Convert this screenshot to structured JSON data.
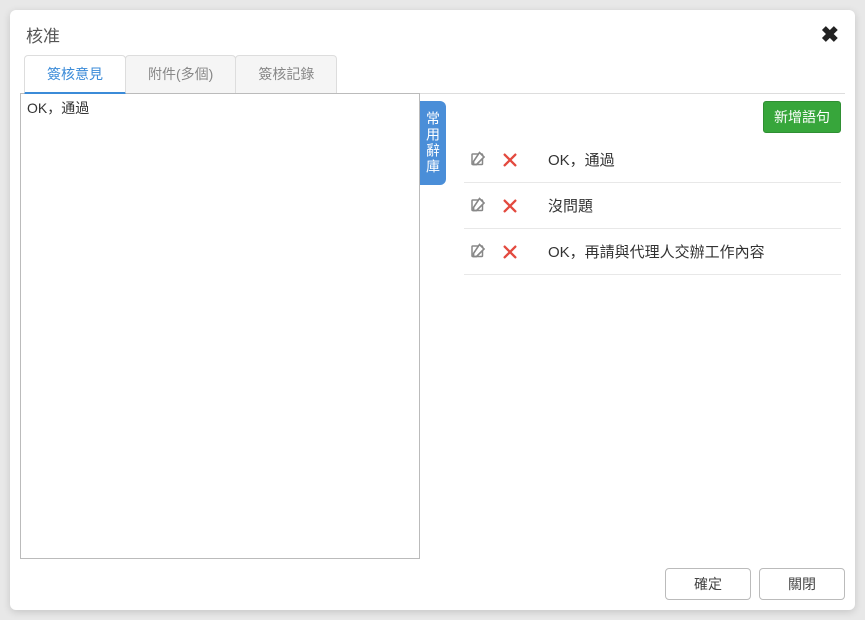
{
  "dialog": {
    "title": "核准"
  },
  "tabs": [
    {
      "label": "簽核意見",
      "active": true
    },
    {
      "label": "附件(多個)",
      "active": false
    },
    {
      "label": "簽核記錄",
      "active": false
    }
  ],
  "textarea_value": "OK，通過",
  "side_tab": {
    "label": "常用辭庫"
  },
  "add_button": {
    "label": "新增語句"
  },
  "phrases": [
    {
      "text": "OK，通過"
    },
    {
      "text": "沒問題"
    },
    {
      "text": "OK，再請與代理人交辦工作內容"
    }
  ],
  "footer": {
    "ok": "確定",
    "close": "關閉"
  }
}
